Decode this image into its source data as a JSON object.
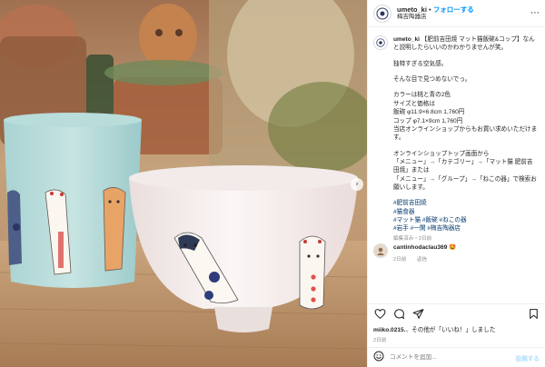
{
  "post": {
    "username": "umeto_ki",
    "separator": "•",
    "follow_label": "フォローする",
    "shop_name": "梅吉陶器店",
    "more_icon": "more-dots-icon"
  },
  "caption": {
    "username": "umeto_ki",
    "title": "【肥前吉田焼 マット猫飯碗&コップ】なんと説明したらいいのかわかりませんが笑。",
    "p1": "独特すぎる空気感。",
    "p2": "そんな目で見つめないでっ。",
    "p3_lines": [
      "カラーは桃と青の2色",
      "サイズと価格は",
      "飯碗 φ11.9×6.8cm 1,760円",
      "コップ φ7.1×9cm 1,760円",
      "当店オンラインショップからもお買い求めいただけます。"
    ],
    "p4_lines": [
      "オンラインショップトップ画面から",
      "「メニュー」→「カテゴリー」→「マット猫 肥前吉田焼」または",
      "「メニュー」→「グループ」→「ねこの器」で検索お願いします。"
    ],
    "hashtags": [
      "#肥前吉田焼",
      "#猫食器",
      "#マット猫 #飯碗 #ねこの器",
      "#岩手 #一関 #梅吉陶器店"
    ],
    "edited": "編集済み・2日前"
  },
  "comment": {
    "username": "cantinhodaclau369",
    "emoji": "🤩",
    "time": "2日前",
    "reply_label": "返信"
  },
  "likes": {
    "user": "miiko.0215.",
    "text": "、その他が「いいね！」しました"
  },
  "date": "2日前",
  "comment_input": {
    "placeholder": "コメントを追加...",
    "post_label": "投稿する"
  },
  "photo": {
    "alt_subject": "cat ceramics",
    "next_arrow": "›"
  }
}
